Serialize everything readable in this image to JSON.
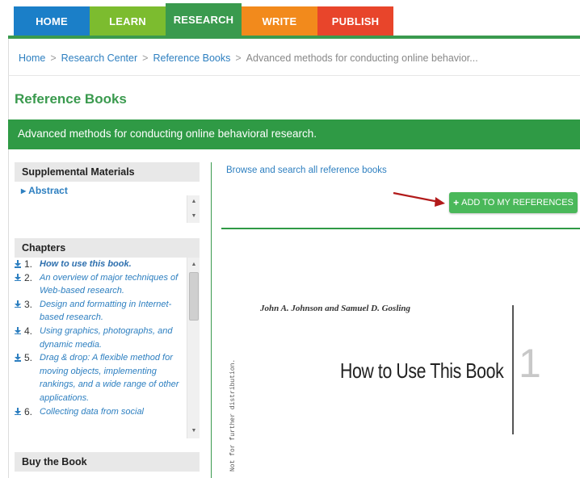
{
  "nav": {
    "tabs": [
      {
        "label": "HOME"
      },
      {
        "label": "LEARN"
      },
      {
        "label": "RESEARCH"
      },
      {
        "label": "WRITE"
      },
      {
        "label": "PUBLISH"
      }
    ],
    "active_tab": "RESEARCH"
  },
  "breadcrumb": {
    "items": [
      "Home",
      "Research Center",
      "Reference Books"
    ],
    "current": "Advanced methods for conducting online behavior..."
  },
  "page_title": "Reference Books",
  "banner_title": "Advanced methods for conducting online behavioral research.",
  "supplemental": {
    "heading": "Supplemental Materials",
    "items": [
      "Abstract"
    ]
  },
  "chapters": {
    "heading": "Chapters",
    "items": [
      {
        "num": "1.",
        "title": "How to use this book."
      },
      {
        "num": "2.",
        "title": "An overview of major techniques of Web-based research."
      },
      {
        "num": "3.",
        "title": "Design and formatting in Internet-based research."
      },
      {
        "num": "4.",
        "title": "Using graphics, photographs, and dynamic media."
      },
      {
        "num": "5.",
        "title": "Drag & drop: A flexible method for moving objects, implementing rankings, and a wide range of other applications."
      },
      {
        "num": "6.",
        "title": "Collecting data from social"
      }
    ]
  },
  "buy": {
    "heading": "Buy the Book"
  },
  "browse_link": "Browse and search all reference books",
  "add_button": {
    "icon": "plus-icon",
    "label": "ADD TO MY REFERENCES"
  },
  "book_preview": {
    "authors": "John A. Johnson and Samuel D. Gosling",
    "title": "How to Use This Book",
    "chapter_number": "1",
    "side_note": "Not for further distribution."
  },
  "colors": {
    "home": "#1b7fc8",
    "learn": "#7cbc2f",
    "research": "#3a9a4e",
    "write": "#f28a1c",
    "publish": "#e8452b",
    "accent_green": "#2f9a45",
    "link": "#2d7fc0"
  }
}
